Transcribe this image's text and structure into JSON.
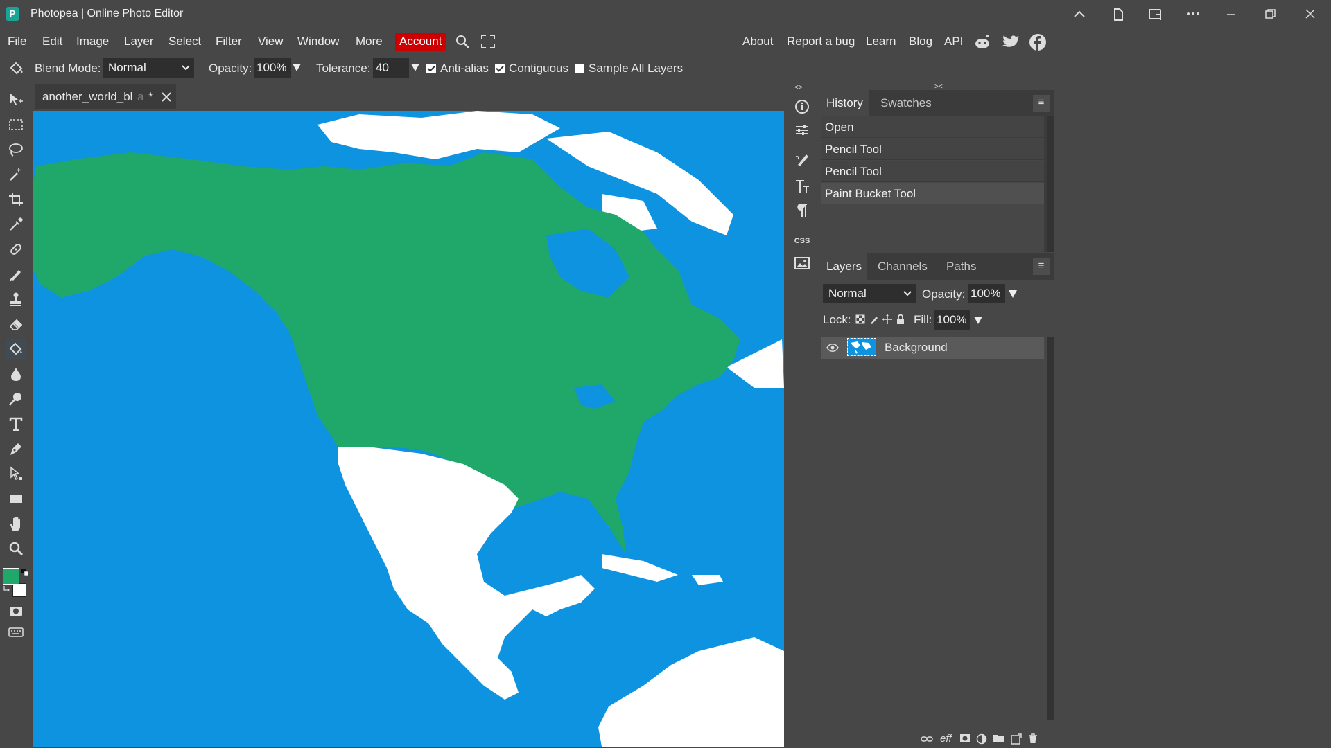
{
  "app": {
    "title": "Photopea | Online Photo Editor",
    "logo_icon": "photopea-logo-icon"
  },
  "window_controls": [
    "chevron-up-icon",
    "document-icon",
    "device-icon",
    "more-icon",
    "minimize-icon",
    "restore-icon",
    "close-icon"
  ],
  "menu": {
    "items": [
      "File",
      "Edit",
      "Image",
      "Layer",
      "Select",
      "Filter",
      "View",
      "Window",
      "More",
      "Account"
    ],
    "account_color": "#cc0000",
    "links": [
      "About",
      "Report a bug",
      "Learn",
      "Blog",
      "API"
    ]
  },
  "options": {
    "blend_mode_label": "Blend Mode:",
    "blend_mode_value": "Normal",
    "opacity_label": "Opacity:",
    "opacity_value": "100%",
    "tolerance_label": "Tolerance:",
    "tolerance_value": "40",
    "anti_alias_label": "Anti-alias",
    "anti_alias_checked": true,
    "contiguous_label": "Contiguous",
    "contiguous_checked": true,
    "sample_all_label": "Sample All Layers",
    "sample_all_checked": false
  },
  "document": {
    "tab_label": "another_world_bl",
    "tab_fade": "a",
    "tab_modified": "*",
    "colors": {
      "ocean": "#0d93e0",
      "land_us_canada": "#1fa86a",
      "land_white": "#ffffff"
    }
  },
  "tools": [
    "move-icon",
    "marquee-icon",
    "lasso-icon",
    "magic-wand-icon",
    "crop-icon",
    "eyedropper-icon",
    "healing-icon",
    "brush-icon",
    "stamp-icon",
    "eraser-icon",
    "paint-bucket-icon",
    "blur-icon",
    "dodge-icon",
    "type-icon",
    "pen-icon",
    "path-select-icon",
    "rectangle-icon",
    "hand-icon",
    "zoom-icon"
  ],
  "colors": {
    "foreground": "#1fa86a",
    "background": "#ffffff"
  },
  "side_icons": {
    "css_label": "CSS",
    "items": [
      "info-icon",
      "adjust-icon",
      "brush-settings-icon",
      "character-icon",
      "paragraph-icon",
      "css-icon",
      "image-icon"
    ]
  },
  "history": {
    "tabs": [
      "History",
      "Swatches"
    ],
    "items": [
      "Open",
      "Pencil Tool",
      "Pencil Tool",
      "Paint Bucket Tool"
    ]
  },
  "layers": {
    "tabs": [
      "Layers",
      "Channels",
      "Paths"
    ],
    "blend_value": "Normal",
    "opacity_label": "Opacity:",
    "opacity_value": "100%",
    "lock_label": "Lock:",
    "fill_label": "Fill:",
    "fill_value": "100%",
    "rows": [
      {
        "name": "Background",
        "visible": true
      }
    ],
    "footer_icons": [
      "link-icon",
      "effects-icon",
      "mask-icon",
      "adjustment-icon",
      "folder-icon",
      "new-layer-icon",
      "trash-icon"
    ],
    "effects_label": "eff"
  }
}
